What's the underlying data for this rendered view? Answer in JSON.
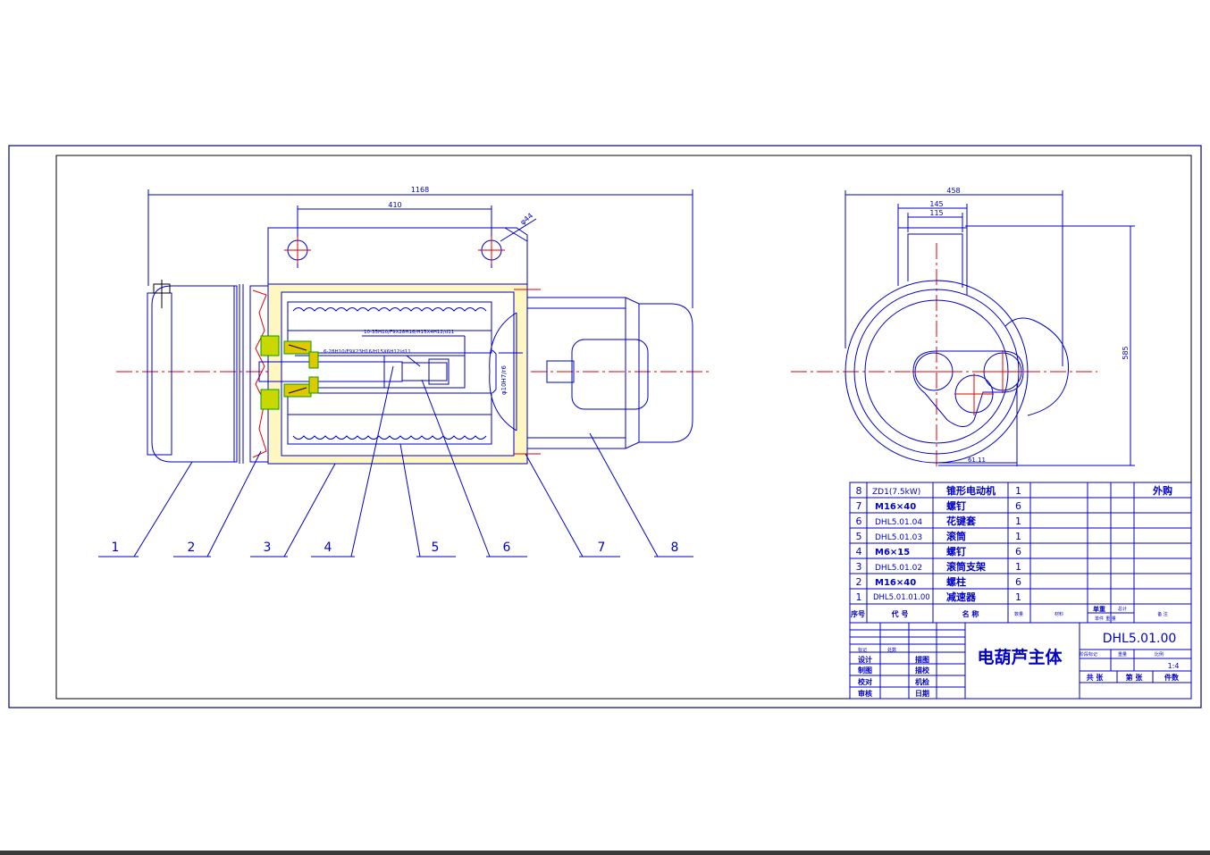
{
  "drawing": {
    "title": "电葫芦主体",
    "drawing_no": "DHL5.01.00",
    "scale": "1:4"
  },
  "dimensions": {
    "overall_length": "1168",
    "hole_spacing": "410",
    "hole_dia": "φ44",
    "fit_motor": "φ10H7/r6",
    "spline_1": "10-35H10/F9X28H16/H15X4H12/d11",
    "spline_2": "6-28H10/F9X23H16/H15X6H12/d11",
    "side_width": "458",
    "side_145": "145",
    "side_115": "115",
    "side_height": "585",
    "offset": "61.11"
  },
  "balloons": [
    "1",
    "2",
    "3",
    "4",
    "5",
    "6",
    "7",
    "8"
  ],
  "bom": {
    "rows": [
      {
        "no": "8",
        "code": "ZD1(7.5kW)",
        "name": "锥形电动机",
        "qty": "1",
        "note": "外购"
      },
      {
        "no": "7",
        "code": "M16×40",
        "name": "螺钉",
        "qty": "6",
        "note": ""
      },
      {
        "no": "6",
        "code": "DHL5.01.04",
        "name": "花键套",
        "qty": "1",
        "note": ""
      },
      {
        "no": "5",
        "code": "DHL5.01.03",
        "name": "滚筒",
        "qty": "1",
        "note": ""
      },
      {
        "no": "4",
        "code": "M6×15",
        "name": "螺钉",
        "qty": "6",
        "note": ""
      },
      {
        "no": "3",
        "code": "DHL5.01.02",
        "name": "滚筒支架",
        "qty": "1",
        "note": ""
      },
      {
        "no": "2",
        "code": "M16×40",
        "name": "螺柱",
        "qty": "6",
        "note": ""
      },
      {
        "no": "1",
        "code": "DHL5.01.01.00",
        "name": "减速器",
        "qty": "1",
        "note": ""
      }
    ],
    "header": {
      "no": "序号",
      "code": "代 号",
      "name": "名 称",
      "qty": "数量",
      "material": "材料",
      "unit": "单重",
      "unit_sub": "单件",
      "total": "总计",
      "total_sub": "重 量",
      "note": "备 注"
    }
  },
  "titleblock": {
    "left_labels": [
      "设计",
      "制图",
      "校对",
      "审核"
    ],
    "mid_labels": [
      "描图",
      "描校",
      "机检",
      "日期"
    ],
    "mark_small": "标记",
    "qty_small": "处数",
    "stage_small": "阶段标记",
    "weight_small": "重量",
    "ratio_small": "比例",
    "sheet_total": "共 张",
    "sheet_no": "第 张",
    "parts": "件数"
  },
  "colors": {
    "border": "#000080",
    "line": "#0000c8",
    "center": "#e00000",
    "hatch": "#c8b000",
    "green": "#00a000",
    "black": "#000000"
  }
}
